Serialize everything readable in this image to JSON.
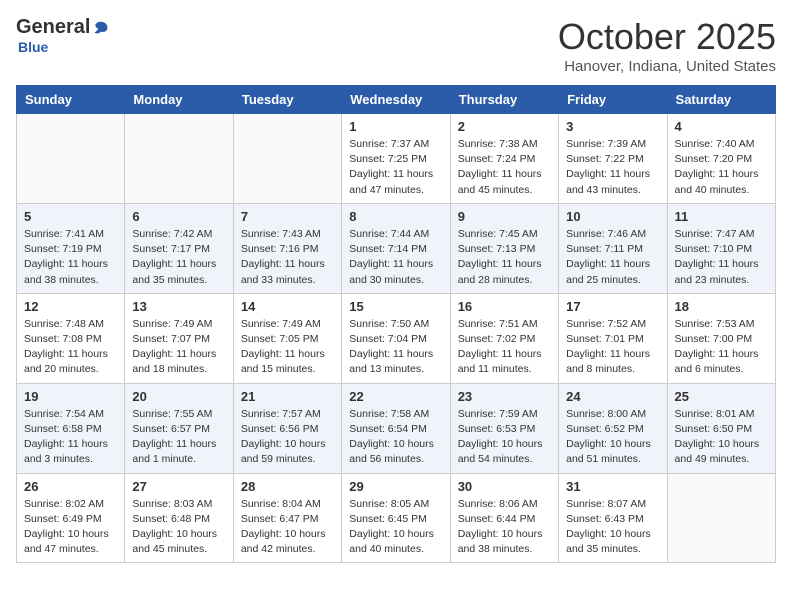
{
  "logo": {
    "general": "General",
    "blue": "Blue"
  },
  "header": {
    "month": "October 2025",
    "location": "Hanover, Indiana, United States"
  },
  "weekdays": [
    "Sunday",
    "Monday",
    "Tuesday",
    "Wednesday",
    "Thursday",
    "Friday",
    "Saturday"
  ],
  "weeks": [
    [
      {
        "day": "",
        "info": ""
      },
      {
        "day": "",
        "info": ""
      },
      {
        "day": "",
        "info": ""
      },
      {
        "day": "1",
        "info": "Sunrise: 7:37 AM\nSunset: 7:25 PM\nDaylight: 11 hours and 47 minutes."
      },
      {
        "day": "2",
        "info": "Sunrise: 7:38 AM\nSunset: 7:24 PM\nDaylight: 11 hours and 45 minutes."
      },
      {
        "day": "3",
        "info": "Sunrise: 7:39 AM\nSunset: 7:22 PM\nDaylight: 11 hours and 43 minutes."
      },
      {
        "day": "4",
        "info": "Sunrise: 7:40 AM\nSunset: 7:20 PM\nDaylight: 11 hours and 40 minutes."
      }
    ],
    [
      {
        "day": "5",
        "info": "Sunrise: 7:41 AM\nSunset: 7:19 PM\nDaylight: 11 hours and 38 minutes."
      },
      {
        "day": "6",
        "info": "Sunrise: 7:42 AM\nSunset: 7:17 PM\nDaylight: 11 hours and 35 minutes."
      },
      {
        "day": "7",
        "info": "Sunrise: 7:43 AM\nSunset: 7:16 PM\nDaylight: 11 hours and 33 minutes."
      },
      {
        "day": "8",
        "info": "Sunrise: 7:44 AM\nSunset: 7:14 PM\nDaylight: 11 hours and 30 minutes."
      },
      {
        "day": "9",
        "info": "Sunrise: 7:45 AM\nSunset: 7:13 PM\nDaylight: 11 hours and 28 minutes."
      },
      {
        "day": "10",
        "info": "Sunrise: 7:46 AM\nSunset: 7:11 PM\nDaylight: 11 hours and 25 minutes."
      },
      {
        "day": "11",
        "info": "Sunrise: 7:47 AM\nSunset: 7:10 PM\nDaylight: 11 hours and 23 minutes."
      }
    ],
    [
      {
        "day": "12",
        "info": "Sunrise: 7:48 AM\nSunset: 7:08 PM\nDaylight: 11 hours and 20 minutes."
      },
      {
        "day": "13",
        "info": "Sunrise: 7:49 AM\nSunset: 7:07 PM\nDaylight: 11 hours and 18 minutes."
      },
      {
        "day": "14",
        "info": "Sunrise: 7:49 AM\nSunset: 7:05 PM\nDaylight: 11 hours and 15 minutes."
      },
      {
        "day": "15",
        "info": "Sunrise: 7:50 AM\nSunset: 7:04 PM\nDaylight: 11 hours and 13 minutes."
      },
      {
        "day": "16",
        "info": "Sunrise: 7:51 AM\nSunset: 7:02 PM\nDaylight: 11 hours and 11 minutes."
      },
      {
        "day": "17",
        "info": "Sunrise: 7:52 AM\nSunset: 7:01 PM\nDaylight: 11 hours and 8 minutes."
      },
      {
        "day": "18",
        "info": "Sunrise: 7:53 AM\nSunset: 7:00 PM\nDaylight: 11 hours and 6 minutes."
      }
    ],
    [
      {
        "day": "19",
        "info": "Sunrise: 7:54 AM\nSunset: 6:58 PM\nDaylight: 11 hours and 3 minutes."
      },
      {
        "day": "20",
        "info": "Sunrise: 7:55 AM\nSunset: 6:57 PM\nDaylight: 11 hours and 1 minute."
      },
      {
        "day": "21",
        "info": "Sunrise: 7:57 AM\nSunset: 6:56 PM\nDaylight: 10 hours and 59 minutes."
      },
      {
        "day": "22",
        "info": "Sunrise: 7:58 AM\nSunset: 6:54 PM\nDaylight: 10 hours and 56 minutes."
      },
      {
        "day": "23",
        "info": "Sunrise: 7:59 AM\nSunset: 6:53 PM\nDaylight: 10 hours and 54 minutes."
      },
      {
        "day": "24",
        "info": "Sunrise: 8:00 AM\nSunset: 6:52 PM\nDaylight: 10 hours and 51 minutes."
      },
      {
        "day": "25",
        "info": "Sunrise: 8:01 AM\nSunset: 6:50 PM\nDaylight: 10 hours and 49 minutes."
      }
    ],
    [
      {
        "day": "26",
        "info": "Sunrise: 8:02 AM\nSunset: 6:49 PM\nDaylight: 10 hours and 47 minutes."
      },
      {
        "day": "27",
        "info": "Sunrise: 8:03 AM\nSunset: 6:48 PM\nDaylight: 10 hours and 45 minutes."
      },
      {
        "day": "28",
        "info": "Sunrise: 8:04 AM\nSunset: 6:47 PM\nDaylight: 10 hours and 42 minutes."
      },
      {
        "day": "29",
        "info": "Sunrise: 8:05 AM\nSunset: 6:45 PM\nDaylight: 10 hours and 40 minutes."
      },
      {
        "day": "30",
        "info": "Sunrise: 8:06 AM\nSunset: 6:44 PM\nDaylight: 10 hours and 38 minutes."
      },
      {
        "day": "31",
        "info": "Sunrise: 8:07 AM\nSunset: 6:43 PM\nDaylight: 10 hours and 35 minutes."
      },
      {
        "day": "",
        "info": ""
      }
    ]
  ]
}
